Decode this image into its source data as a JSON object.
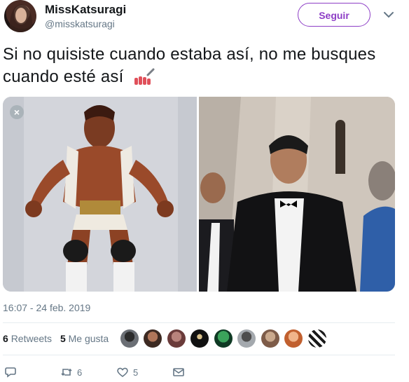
{
  "tweet": {
    "author": {
      "name": "MissKatsuragi",
      "handle": "@misskatsuragi"
    },
    "follow_label": "Seguir",
    "text": "Si no quisiste cuando estaba así, no me busques cuando esté así",
    "text_emoji": "nail-polish-icon",
    "timestamp": "16:07 - 24 feb. 2019",
    "stats": {
      "retweets_count": "6",
      "retweets_label": "Retweets",
      "likes_count": "5",
      "likes_label": "Me gusta"
    },
    "actions": {
      "reply_count": "",
      "retweet_count": "6",
      "like_count": "5"
    },
    "colors": {
      "accent": "#8d3ec6",
      "muted": "#657786",
      "divider": "#e6ecf0"
    }
  }
}
